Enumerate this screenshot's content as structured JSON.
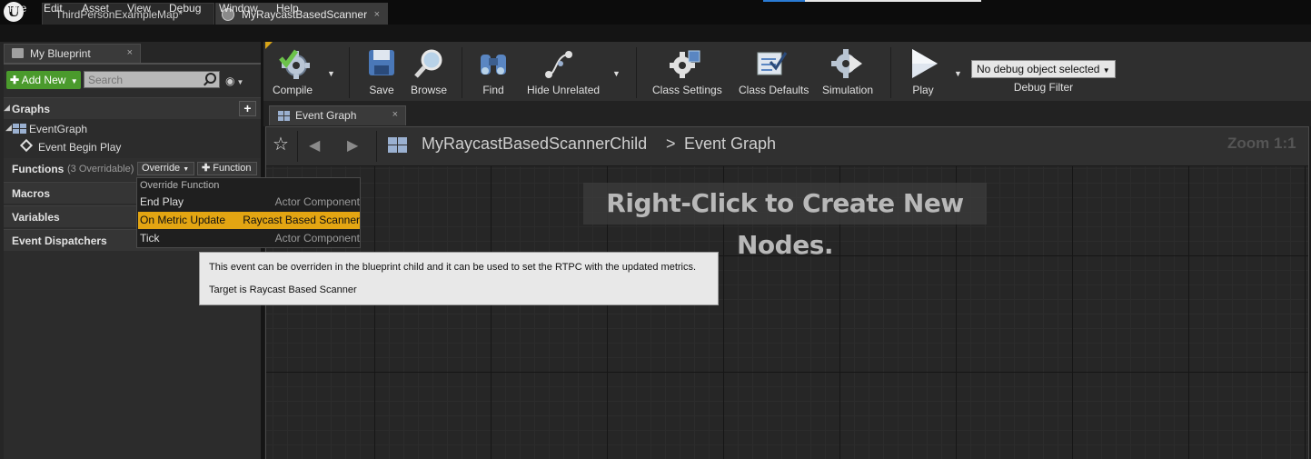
{
  "titlebar": {
    "tabs": [
      {
        "label": "ThirdPersonExampleMap*"
      },
      {
        "label": "MyRaycastBasedScanner",
        "close": "×"
      }
    ],
    "logo": "U"
  },
  "menu": [
    "File",
    "Edit",
    "Asset",
    "View",
    "Debug",
    "Window",
    "Help"
  ],
  "left_panel": {
    "tab_label": "My Blueprint",
    "tab_close": "×",
    "add_new_label": "Add New",
    "search_placeholder": "Search",
    "graphs_title": "Graphs",
    "add_icon": "+",
    "event_graph": "EventGraph",
    "event_begin_play": "Event Begin Play",
    "functions_title": "Functions",
    "functions_count": "(3 Overridable)",
    "override_label": "Override",
    "function_label": "Function",
    "macros_title": "Macros",
    "variables_title": "Variables",
    "event_dispatchers_title": "Event Dispatchers"
  },
  "dropdown": {
    "header": "Override Function",
    "items": [
      {
        "name": "End Play",
        "owner": "Actor Component",
        "selected": false
      },
      {
        "name": "On Metric Update",
        "owner": "Raycast Based Scanner",
        "selected": true
      },
      {
        "name": "Tick",
        "owner": "Actor Component",
        "selected": false
      }
    ]
  },
  "tooltip": {
    "description": "This event can be overriden in the blueprint child and it can be used to set the RTPC with the updated metrics.",
    "target": "Target is Raycast Based Scanner"
  },
  "toolbar": {
    "compile": "Compile",
    "save": "Save",
    "browse": "Browse",
    "find": "Find",
    "hide_unrelated": "Hide Unrelated",
    "class_settings": "Class Settings",
    "class_defaults": "Class Defaults",
    "simulation": "Simulation",
    "play": "Play",
    "debug_object": "No debug object selected",
    "debug_filter": "Debug Filter"
  },
  "graph": {
    "tab_label": "Event Graph",
    "tab_close": "×",
    "breadcrumb_root": "MyRaycastBasedScannerChild",
    "breadcrumb_sep": ">",
    "breadcrumb_leaf": "Event Graph",
    "zoom": "Zoom 1:1",
    "hint": "Right-Click to Create New Nodes."
  },
  "colors": {
    "accent_green": "#4a9a2c",
    "selection_orange": "#e3a512",
    "compile_ok": "#6cc24a"
  }
}
